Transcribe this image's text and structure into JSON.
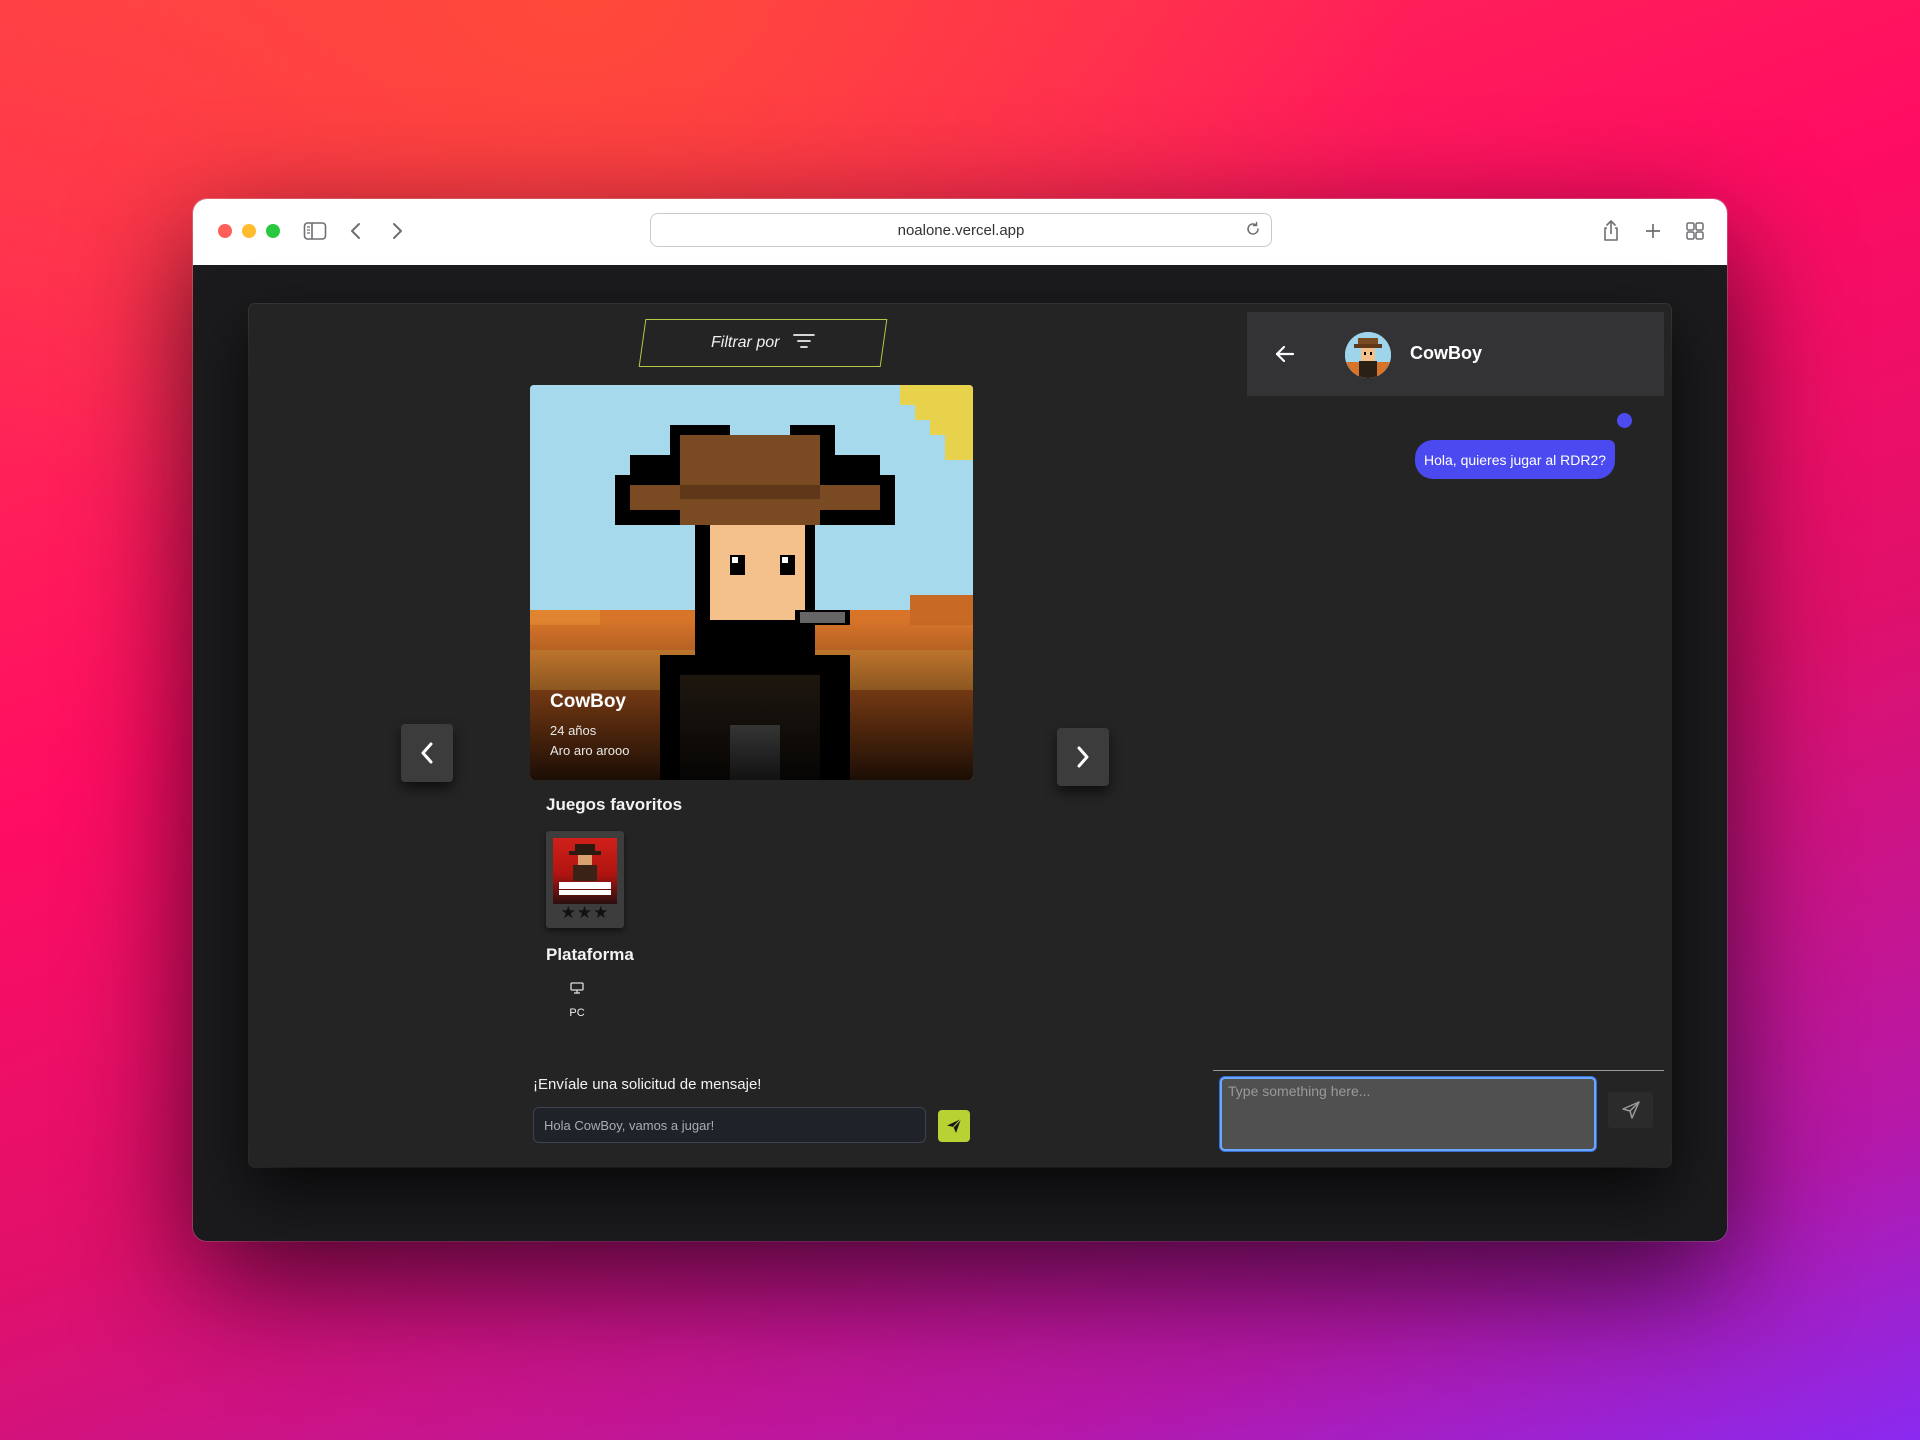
{
  "browser": {
    "url": "noalone.vercel.app"
  },
  "filter": {
    "label": "Filtrar por"
  },
  "profile": {
    "name": "CowBoy",
    "age": "24 años",
    "bio": "Aro aro arooo"
  },
  "favorites": {
    "title": "Juegos favoritos",
    "games": [
      {
        "name": "Red Dead Redemption II",
        "cover_text": "RED DEAD\nREDEMPTION II",
        "rating": "★★★"
      }
    ]
  },
  "platform": {
    "title": "Plataforma",
    "items": [
      {
        "label": "PC",
        "icon": "desktop-icon"
      }
    ]
  },
  "request": {
    "label": "¡Envíale una solicitud de mensaje!",
    "value": "Hola CowBoy, vamos a jugar!"
  },
  "chat": {
    "name": "CowBoy",
    "messages": [
      {
        "text": "Hola, quieres jugar al RDR2?",
        "from": "me"
      }
    ],
    "input_placeholder": "Type something here..."
  },
  "colors": {
    "accent_lime": "#b8d234",
    "chat_bubble": "#4a4af0",
    "focus_ring": "#6aa7ff"
  }
}
